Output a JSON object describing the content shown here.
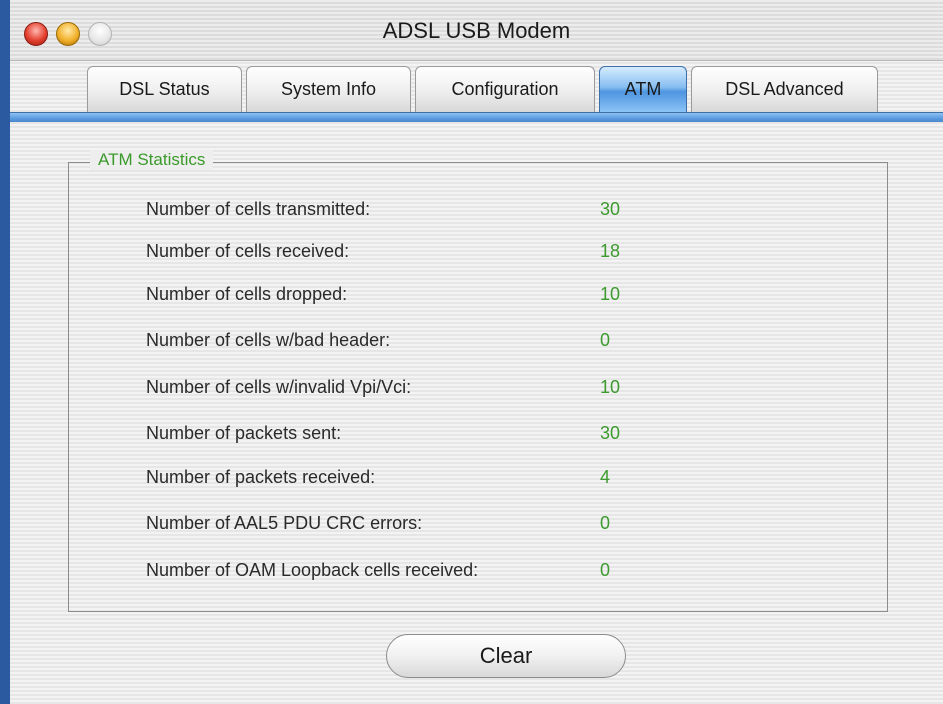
{
  "window": {
    "title": "ADSL USB Modem"
  },
  "tabs": [
    {
      "label": "DSL Status",
      "active": false
    },
    {
      "label": "System Info",
      "active": false
    },
    {
      "label": "Configuration",
      "active": false
    },
    {
      "label": "ATM",
      "active": true
    },
    {
      "label": "DSL Advanced",
      "active": false
    }
  ],
  "atm_statistics": {
    "title": "ATM Statistics",
    "rows": [
      {
        "label": "Number of cells transmitted:",
        "value": "30"
      },
      {
        "label": "Number of cells received:",
        "value": "18"
      },
      {
        "label": "Number of cells dropped:",
        "value": "10"
      },
      {
        "label": "Number of cells w/bad header:",
        "value": "0"
      },
      {
        "label": "Number of cells w/invalid Vpi/Vci:",
        "value": "10"
      },
      {
        "label": "Number of packets sent:",
        "value": "30"
      },
      {
        "label": "Number of packets received:",
        "value": "4"
      },
      {
        "label": "Number of AAL5 PDU CRC errors:",
        "value": "0"
      },
      {
        "label": "Number of OAM Loopback cells received:",
        "value": "0"
      }
    ]
  },
  "buttons": {
    "clear_label": "Clear"
  },
  "colors": {
    "value_green": "#3c9a2e",
    "group_title_green": "#3a9a2a",
    "active_tab_blue": "#4f95e0",
    "desktop_blue": "#2c5aa0"
  }
}
